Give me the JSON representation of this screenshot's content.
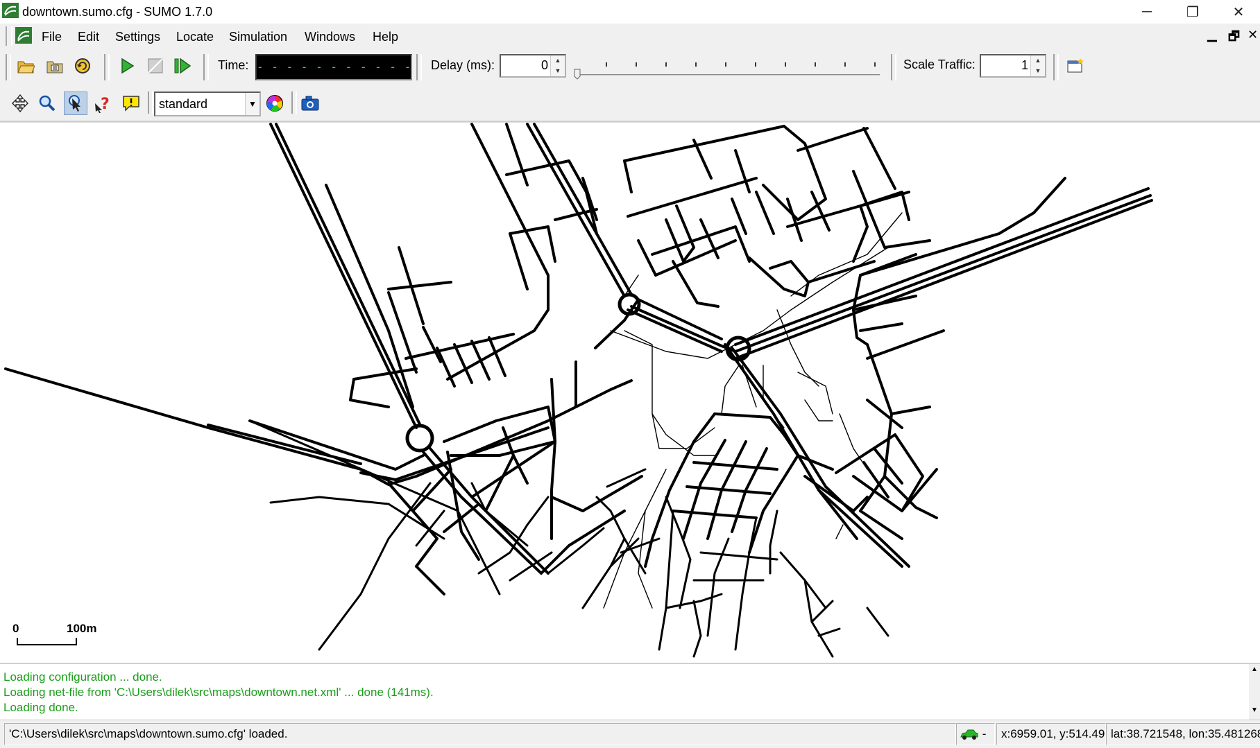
{
  "window": {
    "title": "downtown.sumo.cfg - SUMO 1.7.0",
    "minimize_glyph": "─",
    "restore_glyph": "❐",
    "close_glyph": "✕"
  },
  "menu": {
    "items": [
      {
        "label": "File"
      },
      {
        "label": "Edit"
      },
      {
        "label": "Settings"
      },
      {
        "label": "Locate"
      },
      {
        "label": "Simulation"
      },
      {
        "label": "Windows"
      },
      {
        "label": "Help"
      }
    ],
    "mdi_minimize": "▁",
    "mdi_restore": "🗗",
    "mdi_close": "✕"
  },
  "toolbar": {
    "time_label": "Time:",
    "time_value": "- - - - - - - - - - - - - - - - - - - -",
    "delay_label": "Delay (ms):",
    "delay_value": "0",
    "scale_traffic_label": "Scale Traffic:",
    "scale_traffic_value": "1",
    "slider_level": 0
  },
  "view_toolbar": {
    "color_scheme": "standard"
  },
  "map": {
    "scale_start": "0",
    "scale_end": "100m"
  },
  "messages": [
    "Loading configuration ... done.",
    "Loading net-file from 'C:\\Users\\dilek\\src\\maps\\downtown.net.xml' ... done (141ms).",
    "Loading done."
  ],
  "status": {
    "message": "'C:\\Users\\dilek\\src\\maps\\downtown.sumo.cfg' loaded.",
    "vehicle_count": "-",
    "coords": "x:6959.01, y:514.49",
    "geo": "lat:38.721548, lon:35.481268"
  },
  "colors": {
    "message_text": "#1a9e1a",
    "time_display_bg": "#000000",
    "time_display_fg": "#00ff00",
    "road": "#000000"
  }
}
